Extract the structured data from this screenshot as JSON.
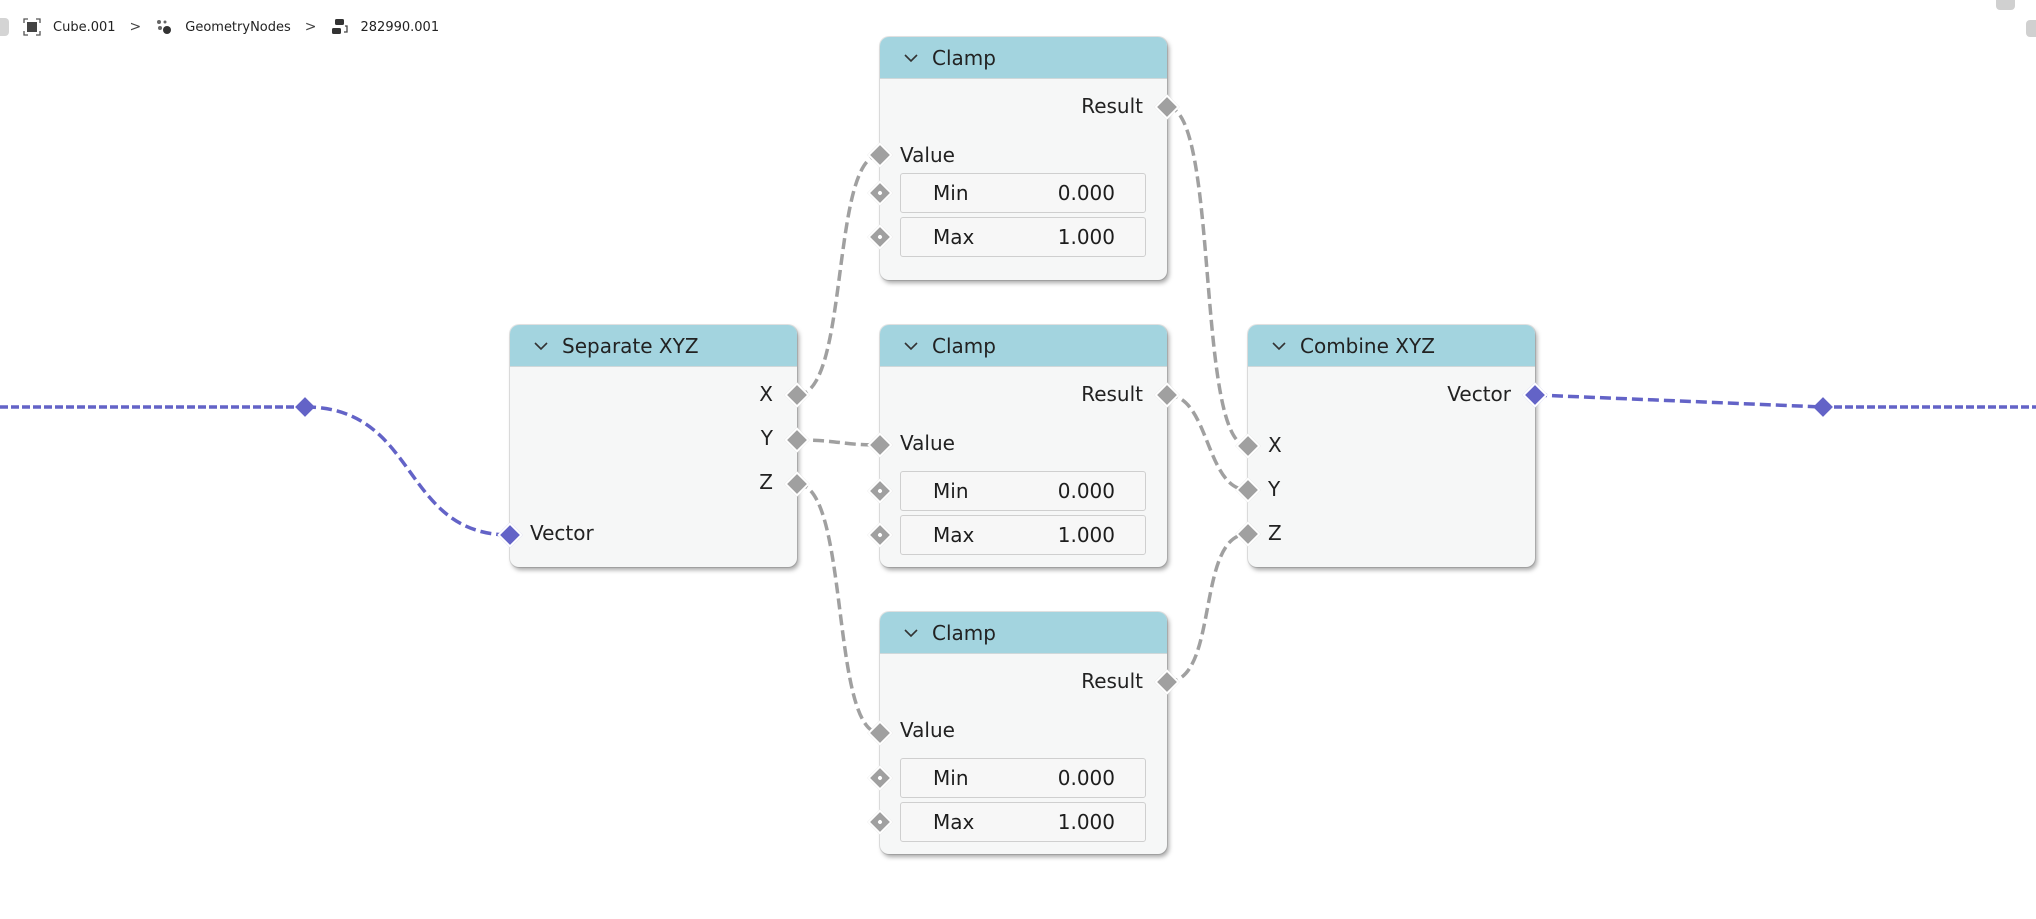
{
  "breadcrumb": {
    "items": [
      {
        "label": "Cube.001",
        "icon": "object-icon"
      },
      {
        "label": "GeometryNodes",
        "icon": "node-tree-icon"
      },
      {
        "label": "282990.001",
        "icon": "node-group-icon"
      }
    ],
    "separator": ">"
  },
  "colors": {
    "header": "#a3d4df",
    "node_body": "#f6f7f7",
    "float_socket": "#a0a0a0",
    "vector_socket": "#6363c7"
  },
  "nodes": {
    "separate": {
      "title": "Separate XYZ",
      "outputs": [
        "X",
        "Y",
        "Z"
      ],
      "inputs": [
        "Vector"
      ]
    },
    "clamp_top": {
      "title": "Clamp",
      "output": "Result",
      "input": "Value",
      "min_label": "Min",
      "min_value": "0.000",
      "max_label": "Max",
      "max_value": "1.000"
    },
    "clamp_mid": {
      "title": "Clamp",
      "output": "Result",
      "input": "Value",
      "min_label": "Min",
      "min_value": "0.000",
      "max_label": "Max",
      "max_value": "1.000"
    },
    "clamp_bot": {
      "title": "Clamp",
      "output": "Result",
      "input": "Value",
      "min_label": "Min",
      "min_value": "0.000",
      "max_label": "Max",
      "max_value": "1.000"
    },
    "combine": {
      "title": "Combine XYZ",
      "outputs": [
        "Vector"
      ],
      "inputs": [
        "X",
        "Y",
        "Z"
      ]
    }
  }
}
